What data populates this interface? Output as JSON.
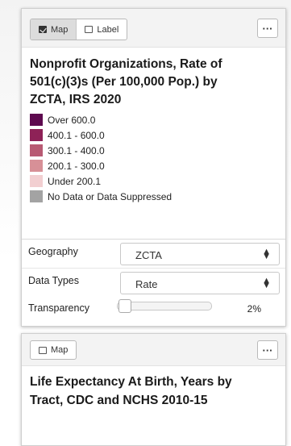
{
  "panels": [
    {
      "toggle": [
        {
          "label": "Map",
          "checked": true
        },
        {
          "label": "Label",
          "checked": false
        }
      ],
      "more_label": "···",
      "title": "Nonprofit Organizations, Rate of 501(c)(3)s (Per 100,000 Pop.) by ZCTA, IRS 2020",
      "legend": [
        {
          "label": "Over 600.0",
          "color": "#5e0a4f"
        },
        {
          "label": "400.1 - 600.0",
          "color": "#8e2257"
        },
        {
          "label": "300.1 - 400.0",
          "color": "#b85a73"
        },
        {
          "label": "200.1 - 300.0",
          "color": "#d79097"
        },
        {
          "label": "Under 200.1",
          "color": "#f2cfd1"
        },
        {
          "label": "No Data or Data Suppressed",
          "color": "#a3a3a3"
        }
      ],
      "controls": {
        "geography": {
          "label": "Geography",
          "value": "ZCTA"
        },
        "data_types": {
          "label": "Data Types",
          "value": "Rate"
        },
        "transparency": {
          "label": "Transparency",
          "value": "2%",
          "level": 0.02
        }
      }
    },
    {
      "toggle": [
        {
          "label": "Map",
          "checked": false
        }
      ],
      "more_label": "···",
      "title": "Life Expectancy At Birth, Years by Tract, CDC and NCHS 2010-15"
    }
  ],
  "icons": {
    "select_arrows": "updown-chevrons-icon",
    "more": "ellipsis-icon"
  }
}
